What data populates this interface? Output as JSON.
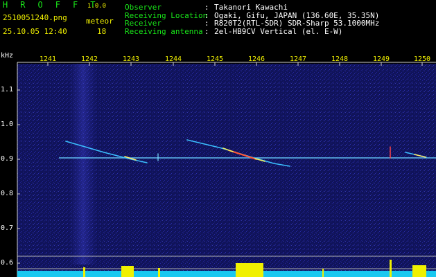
{
  "header": {
    "app_name": "H R O F F T",
    "version": "1.0.0",
    "filename": "2510051240.png",
    "meteor_label": "meteor",
    "datetime": "25.10.05 12:40",
    "meteor_count": "18"
  },
  "meta": [
    {
      "key": "Observer",
      "value": "Takanori Kawachi"
    },
    {
      "key": "Receiving Location",
      "value": "Ogaki, Gifu, JAPAN (136.60E, 35.35N)"
    },
    {
      "key": "Receiver",
      "value": "R820T2(RTL-SDR) SDR-Sharp 53.1000MHz"
    },
    {
      "key": "Receiving antenna",
      "value": "2el-HB9CV Vertical (el. E-W)"
    }
  ],
  "axes": {
    "unit_label": "kHz",
    "y_ticks": [
      "1.1",
      "1.0",
      "0.9",
      "0.8",
      "0.7",
      "0.6"
    ],
    "x_ticks": [
      "1241",
      "1242",
      "1243",
      "1244",
      "1245",
      "1246",
      "1247",
      "1248",
      "1249",
      "1250"
    ]
  },
  "colors": {
    "background": "#000000",
    "header_title": "#19e619",
    "header_info": "#f0f000",
    "axis_x_labels": "#f0f000",
    "noise": "#1a1c7a",
    "trace": "#33bbff",
    "trace_hot": "#ff3333",
    "baseline_meter": "#19c8f0"
  }
}
